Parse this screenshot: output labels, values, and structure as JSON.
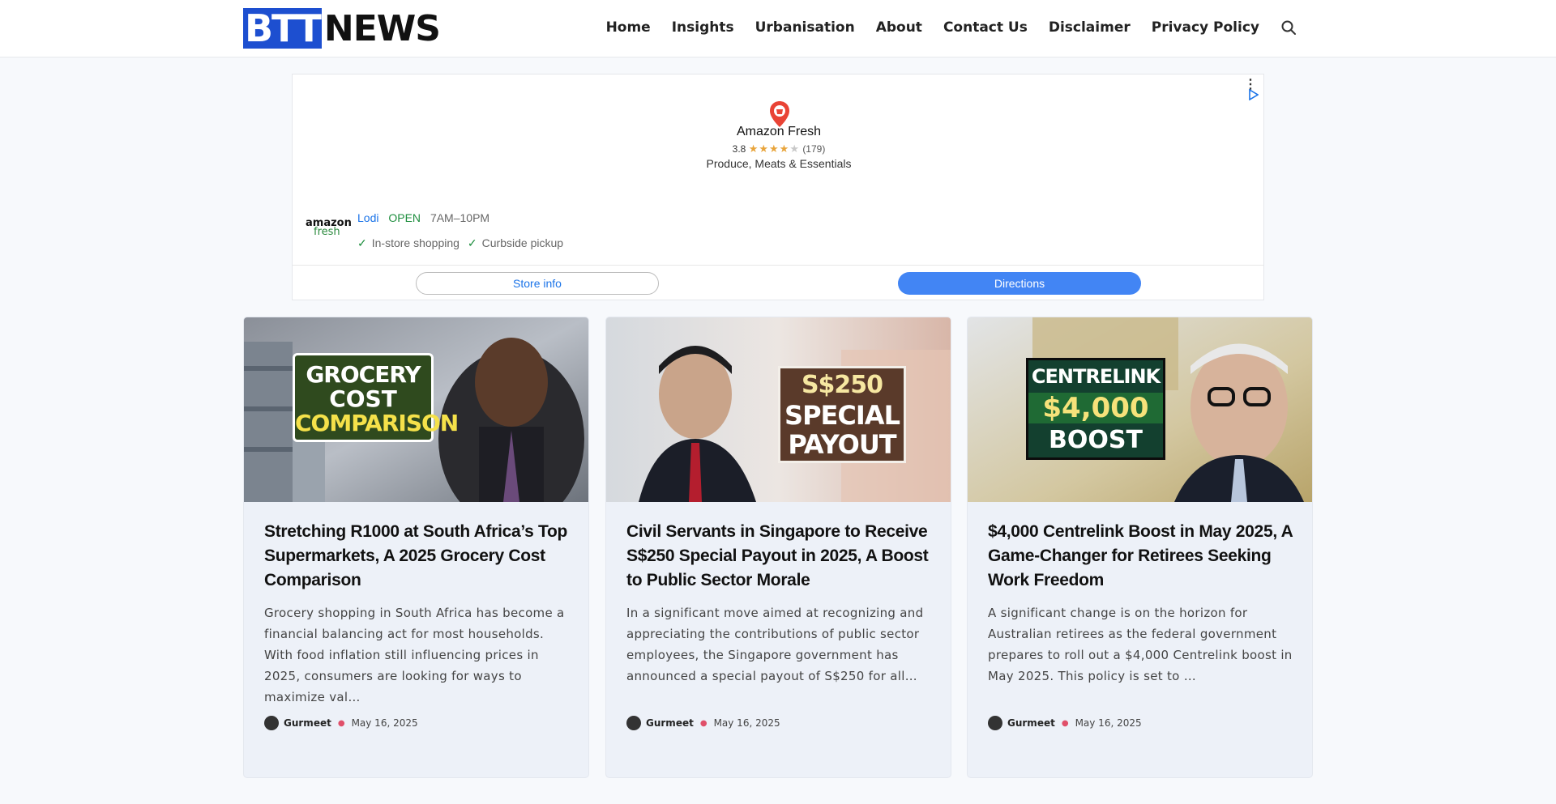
{
  "site": {
    "logo_part1": "BTT",
    "logo_part2": "NEWS"
  },
  "nav": {
    "items": [
      "Home",
      "Insights",
      "Urbanisation",
      "About",
      "Contact Us",
      "Disclaimer",
      "Privacy Policy"
    ],
    "search_icon": "search-icon"
  },
  "ad": {
    "store_name": "Amazon Fresh",
    "rating": "3.8",
    "review_count": "(179)",
    "rating_stars": 3.8,
    "category": "Produce, Meats & Essentials",
    "brand_line1": "amazon",
    "brand_line2": "fresh",
    "city": "Lodi",
    "status": "OPEN",
    "hours": "7AM–10PM",
    "feature1": "In-store shopping",
    "feature2": "Curbside pickup",
    "btn_info": "Store info",
    "btn_directions": "Directions",
    "colors": {
      "link": "#1a73e8",
      "open": "#1e8e3e",
      "button": "#4285f4",
      "star": "#e8a43b"
    }
  },
  "cards": [
    {
      "image_text": [
        "GROCERY",
        "COST",
        "COMPARISON"
      ],
      "title": "Stretching R1000 at South Africa’s Top Supermarkets, A 2025 Grocery Cost Comparison",
      "excerpt": "Grocery shopping in South Africa has become a financial balancing act for most households. With food inflation still influencing prices in 2025, consumers are looking for ways to maximize val…",
      "author": "Gurmeet",
      "date": "May 16, 2025"
    },
    {
      "image_text": [
        "S$250",
        "SPECIAL",
        "PAYOUT"
      ],
      "title": "Civil Servants in Singapore to Receive S$250 Special Payout in 2025, A Boost to Public Sector Morale",
      "excerpt": "In a significant move aimed at recognizing and appreciating the contributions of public sector employees, the Singapore government has announced a special payout of S$250 for all…",
      "author": "Gurmeet",
      "date": "May 16, 2025"
    },
    {
      "image_text": [
        "CENTRELINK",
        "$4,000",
        "BOOST"
      ],
      "title": "$4,000 Centrelink Boost in May 2025, A Game-Changer for Retirees Seeking Work Freedom",
      "excerpt": "A significant change is on the horizon for Australian retirees as the federal government prepares to roll out a $4,000 Centrelink boost in May 2025. This policy is set to …",
      "author": "Gurmeet",
      "date": "May 16, 2025"
    }
  ]
}
